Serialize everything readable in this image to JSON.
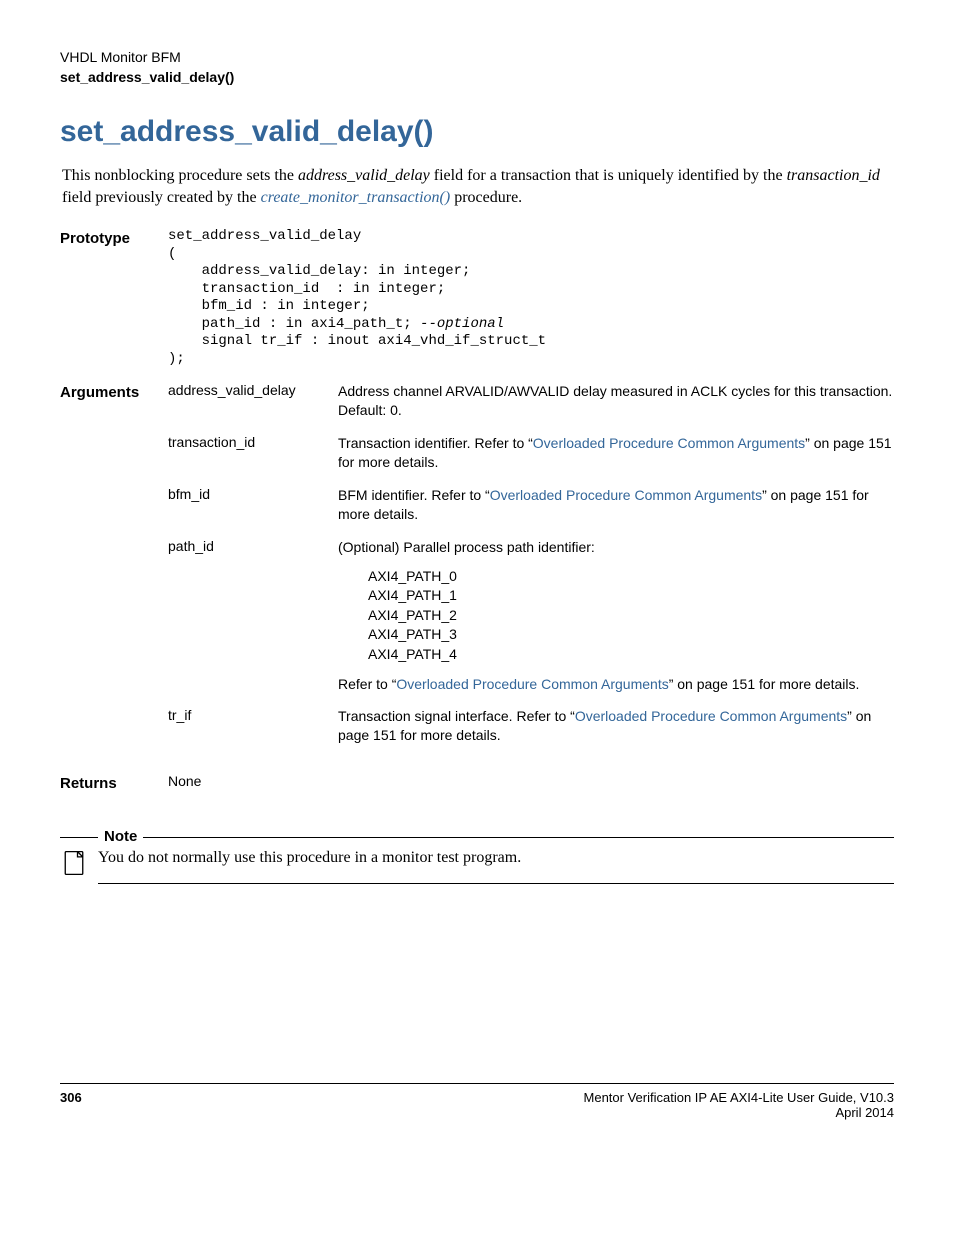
{
  "header": {
    "line1": "VHDL Monitor BFM",
    "line2": "set_address_valid_delay()"
  },
  "title": "set_address_valid_delay()",
  "intro": {
    "t1": "This nonblocking procedure sets the ",
    "ital1": "address_valid_delay",
    "t2": " field for a transaction that is uniquely identified by the ",
    "ital2": "transaction_id",
    "t3": " field previously created by the ",
    "link1": "create_monitor_transaction()",
    "t4": " procedure."
  },
  "labels": {
    "prototype": "Prototype",
    "arguments": "Arguments",
    "returns": "Returns",
    "note": "Note"
  },
  "prototype": {
    "line1": "set_address_valid_delay",
    "line2": "(",
    "line3": "    address_valid_delay: in integer;",
    "line4": "    transaction_id  : in integer;",
    "line5": "    bfm_id : in integer;",
    "line6a": "    path_id : in axi4_path_t; ",
    "line6b": "--optional",
    "line7": "    signal tr_if : inout axi4_vhd_if_struct_t",
    "line8": ");"
  },
  "args": {
    "a1": {
      "name": "address_valid_delay",
      "desc": "Address channel ARVALID/AWVALID delay measured in ACLK cycles for this transaction. Default: 0."
    },
    "a2": {
      "name": "transaction_id",
      "t1": "Transaction identifier. Refer to “",
      "link": "Overloaded Procedure Common Arguments",
      "t2": "” on page 151 for more details."
    },
    "a3": {
      "name": "bfm_id",
      "t1": "BFM identifier. Refer to “",
      "link": "Overloaded Procedure Common Arguments",
      "t2": "” on page 151 for more details."
    },
    "a4": {
      "name": "path_id",
      "t1": "(Optional) Parallel process path identifier:",
      "p0": "AXI4_PATH_0",
      "p1": "AXI4_PATH_1",
      "p2": "AXI4_PATH_2",
      "p3": "AXI4_PATH_3",
      "p4": "AXI4_PATH_4",
      "t2a": "Refer to “",
      "link2": "Overloaded Procedure Common Arguments",
      "t2b": "” on page 151 for more details."
    },
    "a5": {
      "name": "tr_if",
      "t1": "Transaction signal interface. Refer to “",
      "link": "Overloaded Procedure Common Arguments",
      "t2": "” on page 151 for more details."
    }
  },
  "returns": "None",
  "note_text": "You do not normally use this procedure in a monitor test program.",
  "footer": {
    "page": "306",
    "title": "Mentor Verification IP AE AXI4-Lite User Guide, V10.3",
    "date": "April 2014"
  }
}
